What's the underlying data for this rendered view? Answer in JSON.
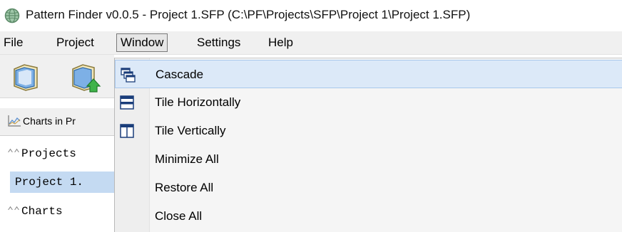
{
  "window": {
    "title": "Pattern Finder v0.0.5 - Project 1.SFP (C:\\PF\\Projects\\SFP\\Project 1\\Project 1.SFP)"
  },
  "menubar": {
    "items": [
      {
        "label": "File"
      },
      {
        "label": "Project"
      },
      {
        "label": "Window"
      },
      {
        "label": "Settings"
      },
      {
        "label": "Help"
      }
    ]
  },
  "left_panel": {
    "charts_tab_label": "Charts in Pr",
    "projects_header": "Projects",
    "project_item": "Project 1.",
    "charts_header": "Charts",
    "chevron": "⌃⌃"
  },
  "window_menu": {
    "items": [
      {
        "label": "Cascade",
        "icon": "cascade-icon"
      },
      {
        "label": "Tile Horizontally",
        "icon": "tile-horizontal-icon"
      },
      {
        "label": "Tile Vertically",
        "icon": "tile-vertical-icon"
      },
      {
        "label": "Minimize All"
      },
      {
        "label": "Restore All"
      },
      {
        "label": "Close All"
      }
    ]
  },
  "colors": {
    "menu_highlight": "#dce9f8",
    "selected_row": "#c4daf2",
    "menu_background": "#f5f5f5"
  }
}
